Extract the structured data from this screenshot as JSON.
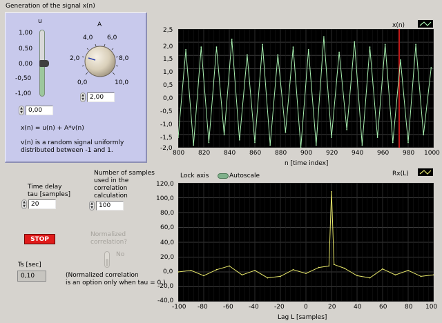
{
  "generation_panel": {
    "title": "Generation of the signal x(n)",
    "u_label": "u",
    "u_scale": [
      "1,00",
      "0,50",
      "0,00",
      "-0,50",
      "-1,00"
    ],
    "u_value": "0,00",
    "a_label": "A",
    "a_scale": [
      "0,0",
      "2,0",
      "4,0",
      "6,0",
      "8,0",
      "10,0"
    ],
    "a_value": "2,00",
    "formula": "x(n) = u(n) + A*v(n)",
    "note_line1": "v(n) is a random signal uniformly",
    "note_line2": "distributed between -1 and 1."
  },
  "controls": {
    "tau_label_line1": "Time delay",
    "tau_label_line2": "tau [samples]",
    "tau_value": "20",
    "nsamples_label_line1": "Number of samples",
    "nsamples_label_line2": "used in the",
    "nsamples_label_line3": "correlation",
    "nsamples_label_line4": "calculation",
    "nsamples_value": "100",
    "normalized_label_line1": "Normalized",
    "normalized_label_line2": "correlation?",
    "normalized_state": "No",
    "stop_label": "STOP",
    "ts_label": "Ts [sec]",
    "ts_value": "0,10",
    "norm_note_line1": "(Normalized correlation",
    "norm_note_line2": "is an option only when tau = 0.)"
  },
  "graph_x": {
    "legend": "x(n)",
    "xlabel": "n [time index]",
    "x_ticks": [
      "800",
      "820",
      "840",
      "860",
      "880",
      "900",
      "920",
      "940",
      "960",
      "980",
      "1000"
    ],
    "y_ticks": [
      "2,5",
      "2,0",
      "1,5",
      "1,0",
      "0,5",
      "0,0",
      "-0,5",
      "-1,0",
      "-1,5",
      "-2,0"
    ]
  },
  "graph_r": {
    "legend": "Rx(L)",
    "lock_axis": "Lock axis",
    "autoscale": "Autoscale",
    "xlabel": "Lag L [samples]",
    "x_ticks": [
      "-100",
      "-80",
      "-60",
      "-40",
      "-20",
      "0",
      "20",
      "40",
      "60",
      "80",
      "100"
    ],
    "y_ticks": [
      "120,0",
      "100,0",
      "80,0",
      "60,0",
      "40,0",
      "20,0",
      "0,0",
      "-20,0",
      "-40,0"
    ]
  },
  "colors": {
    "panel": "#c8c9ec",
    "window": "#d6d3ce",
    "trace_x": "#a8f0b0",
    "trace_r": "#e8e86a",
    "cursor": "#c01818",
    "stop": "#e01b1b"
  },
  "chart_data": [
    {
      "type": "line",
      "title": "",
      "legend": "x(n)",
      "xlabel": "n [time index]",
      "ylabel": "",
      "xlim": [
        800,
        1000
      ],
      "ylim": [
        -2.0,
        2.6
      ],
      "grid": true,
      "x": [
        800,
        806,
        812,
        818,
        824,
        830,
        836,
        842,
        848,
        854,
        860,
        866,
        872,
        878,
        884,
        890,
        896,
        902,
        908,
        914,
        920,
        926,
        932,
        938,
        944,
        950,
        956,
        962,
        968,
        974,
        980,
        986,
        992,
        998
      ],
      "values": [
        -1.6,
        1.8,
        -1.9,
        1.9,
        -1.8,
        1.9,
        -1.5,
        2.2,
        -1.7,
        1.6,
        -1.8,
        2.0,
        -1.9,
        1.6,
        -1.4,
        1.9,
        -2.0,
        1.8,
        -1.9,
        2.3,
        -1.6,
        1.7,
        -1.3,
        2.1,
        -1.9,
        1.9,
        -1.6,
        2.0,
        -1.8,
        1.4,
        -1.8,
        2.0,
        -1.5,
        1.1
      ],
      "cursor_x": 973
    },
    {
      "type": "line",
      "title": "",
      "legend": "Rx(L)",
      "xlabel": "Lag L [samples]",
      "ylabel": "",
      "xlim": [
        -100,
        100
      ],
      "ylim": [
        -40,
        120
      ],
      "grid": true,
      "x": [
        -100,
        -90,
        -80,
        -70,
        -60,
        -50,
        -40,
        -30,
        -20,
        -10,
        0,
        10,
        18,
        20,
        22,
        30,
        40,
        50,
        60,
        70,
        80,
        90,
        100
      ],
      "values": [
        0,
        2,
        -5,
        3,
        8,
        -4,
        2,
        -8,
        -6,
        3,
        -2,
        6,
        8,
        108,
        10,
        5,
        -5,
        -8,
        4,
        -4,
        2,
        -6,
        -4
      ]
    }
  ]
}
